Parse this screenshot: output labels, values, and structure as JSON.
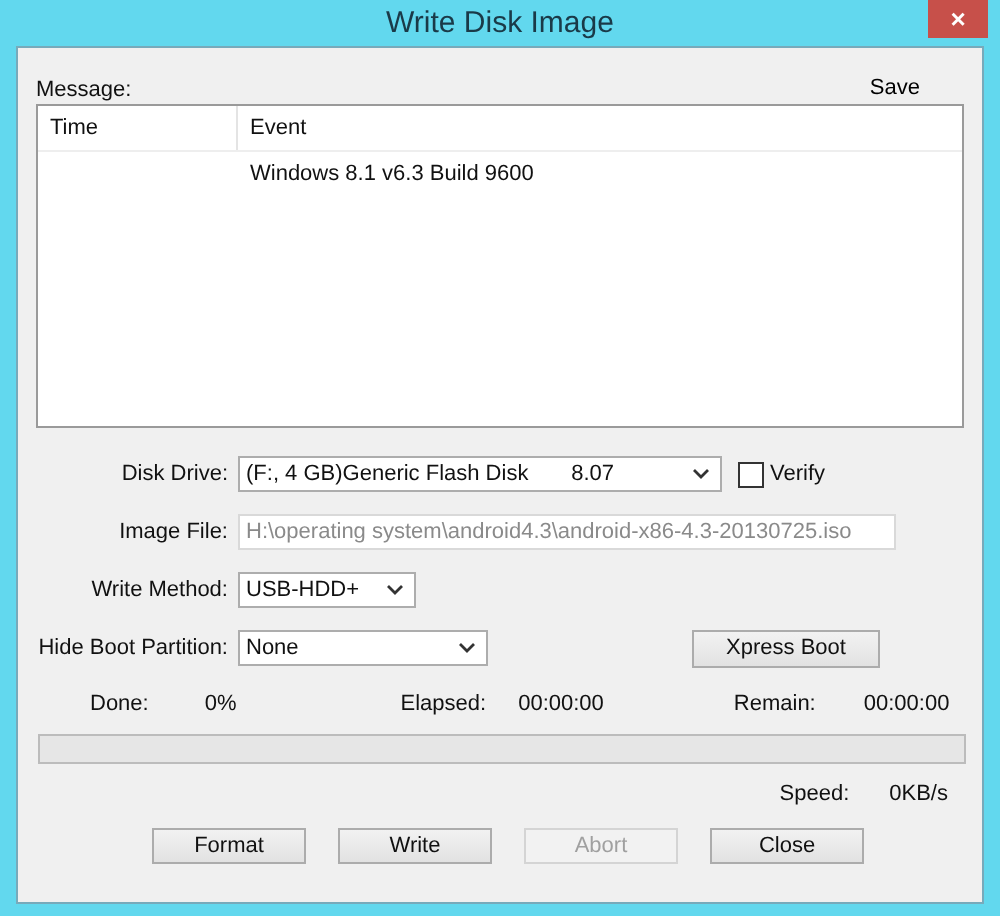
{
  "window": {
    "title": "Write Disk Image",
    "close": "×"
  },
  "message": {
    "label": "Message:",
    "save_button": "Save",
    "columns": [
      "Time",
      "Event"
    ],
    "rows": [
      {
        "time": "",
        "event": "Windows 8.1 v6.3 Build 9600"
      }
    ]
  },
  "form": {
    "disk_drive": {
      "label": "Disk Drive:",
      "value": "(F:, 4 GB)Generic Flash Disk       8.07"
    },
    "verify": {
      "label": "Verify",
      "checked": false
    },
    "image_file": {
      "label": "Image File:",
      "value": "H:\\operating system\\android4.3\\android-x86-4.3-20130725.iso",
      "disabled": true
    },
    "write_method": {
      "label": "Write Method:",
      "value": "USB-HDD+"
    },
    "hide_boot_partition": {
      "label": "Hide Boot Partition:",
      "value": "None"
    },
    "xpress_boot_button": "Xpress Boot"
  },
  "progress": {
    "done_label": "Done:",
    "done": "0%",
    "elapsed_label": "Elapsed:",
    "elapsed": "00:00:00",
    "remain_label": "Remain:",
    "remain": "00:00:00",
    "level": 0,
    "speed_label": "Speed:",
    "speed": "0KB/s"
  },
  "buttons": [
    {
      "label": "Format",
      "disabled": false
    },
    {
      "label": "Write",
      "disabled": false
    },
    {
      "label": "Abort",
      "disabled": true
    },
    {
      "label": "Close",
      "disabled": false
    }
  ]
}
